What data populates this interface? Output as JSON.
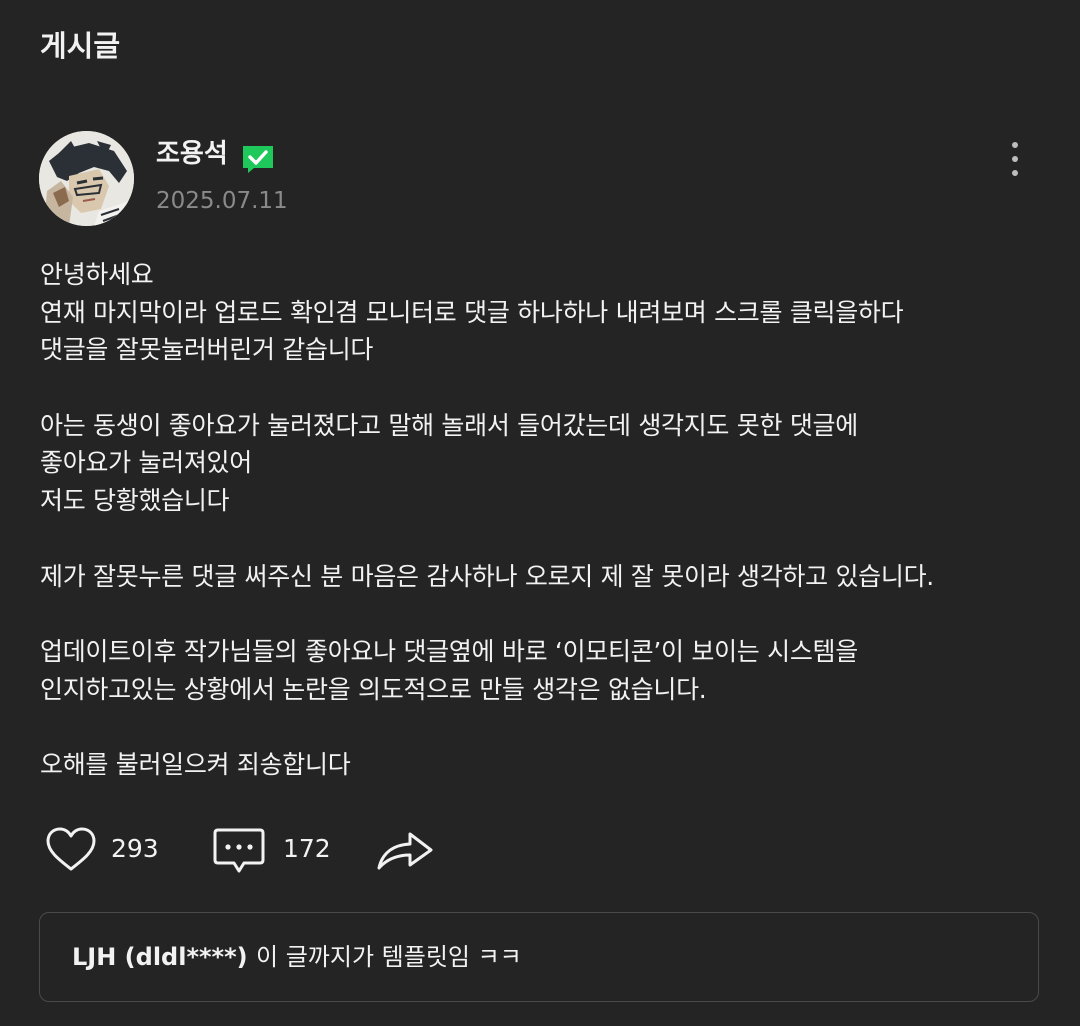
{
  "header": {
    "title": "게시글"
  },
  "post": {
    "author": {
      "name": "조용석",
      "verified_badge_icon": "verified-check-icon",
      "badge_color": "#1ec85a"
    },
    "date": "2025.07.11",
    "more_icon": "more-vertical-icon",
    "body_lines": [
      "안녕하세요",
      "연재 마지막이라 업로드 확인겸 모니터로 댓글 하나하나 내려보며 스크롤 클릭을하다",
      "댓글을 잘못눌러버린거 같습니다",
      "",
      "아는 동생이 좋아요가 눌러졌다고 말해 놀래서 들어갔는데 생각지도 못한 댓글에",
      "좋아요가 눌러져있어",
      "저도 당황했습니다",
      "",
      "제가 잘못누른 댓글 써주신 분 마음은 감사하나 오로지 제 잘 못이라 생각하고 있습니다.",
      "",
      "업데이트이후 작가님들의 좋아요나 댓글옆에 바로 ‘이모티콘’이 보이는 시스템을",
      "인지하고있는 상황에서 논란을 의도적으로 만들 생각은 없습니다.",
      "",
      "오해를 불러일으켜 죄송합니다"
    ],
    "actions": {
      "like_icon": "heart-icon",
      "like_count": "293",
      "comment_icon": "comment-bubble-icon",
      "comment_count": "172",
      "share_icon": "share-arrow-icon"
    }
  },
  "comment_preview": {
    "author": "LJH (dldl****)",
    "text": "이 글까지가 템플릿임 ㅋㅋ"
  },
  "colors": {
    "background": "#242424",
    "text": "#f2f2f2",
    "muted": "#8a8a8a",
    "border": "#4a4a4a",
    "accent": "#1ec85a"
  }
}
